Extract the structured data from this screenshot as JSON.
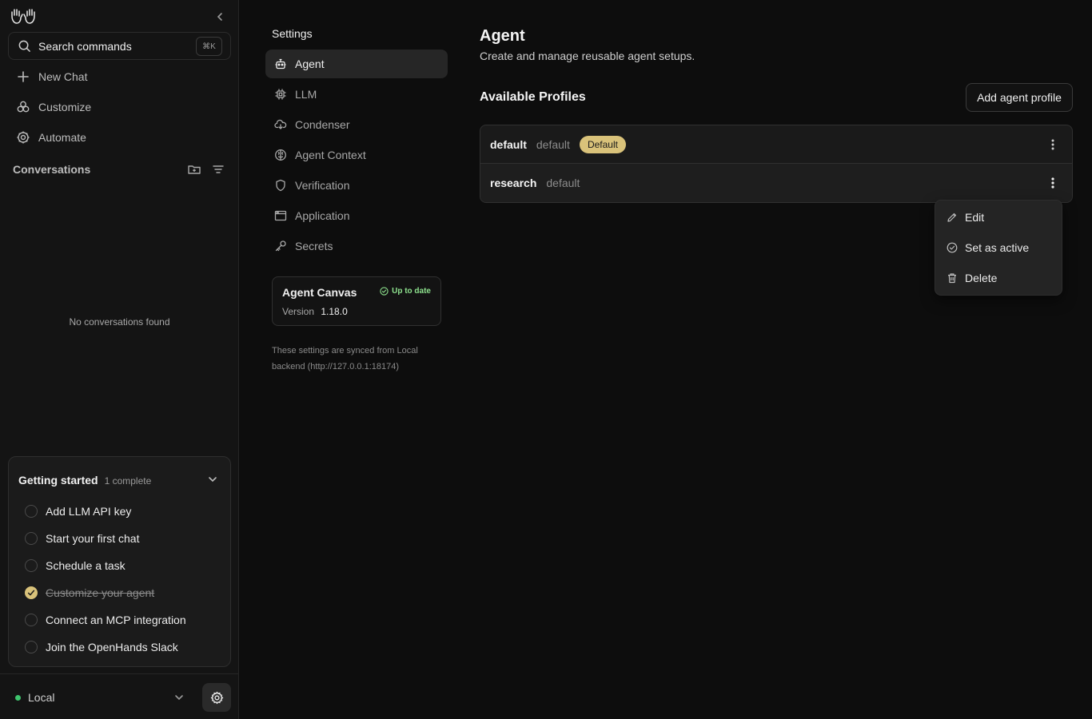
{
  "sidebar": {
    "search": {
      "label": "Search commands",
      "shortcut": "⌘K"
    },
    "nav": [
      {
        "label": "New Chat",
        "icon": "plus-icon"
      },
      {
        "label": "Customize",
        "icon": "customize-icon"
      },
      {
        "label": "Automate",
        "icon": "automate-gear-icon"
      }
    ],
    "conversations": {
      "title": "Conversations",
      "empty": "No conversations found"
    },
    "getting_started": {
      "title": "Getting started",
      "subtitle": "1 complete",
      "items": [
        {
          "label": "Add LLM API key",
          "done": false
        },
        {
          "label": "Start your first chat",
          "done": false
        },
        {
          "label": "Schedule a task",
          "done": false
        },
        {
          "label": "Customize your agent",
          "done": true
        },
        {
          "label": "Connect an MCP integration",
          "done": false
        },
        {
          "label": "Join the OpenHands Slack",
          "done": false
        }
      ]
    },
    "footer": {
      "backend": "Local",
      "status_color": "#3ec46d"
    }
  },
  "settings_nav": {
    "title": "Settings",
    "items": [
      {
        "label": "Agent",
        "icon": "robot-icon",
        "active": true
      },
      {
        "label": "LLM",
        "icon": "chip-icon",
        "active": false
      },
      {
        "label": "Condenser",
        "icon": "condenser-icon",
        "active": false
      },
      {
        "label": "Agent Context",
        "icon": "brain-icon",
        "active": false
      },
      {
        "label": "Verification",
        "icon": "shield-icon",
        "active": false
      },
      {
        "label": "Application",
        "icon": "window-icon",
        "active": false
      },
      {
        "label": "Secrets",
        "icon": "key-icon",
        "active": false
      }
    ],
    "version_card": {
      "name": "Agent Canvas",
      "status": "Up to date",
      "version_label": "Version",
      "version": "1.18.0"
    },
    "sync_note": "These settings are synced from Local backend (http://127.0.0.1:18174)"
  },
  "main": {
    "title": "Agent",
    "subtitle": "Create and manage reusable agent setups.",
    "profiles_title": "Available Profiles",
    "add_button": "Add agent profile",
    "profiles": [
      {
        "name": "default",
        "model": "default",
        "badge": "Default"
      },
      {
        "name": "research",
        "model": "default",
        "badge": ""
      }
    ],
    "context_menu": [
      {
        "label": "Edit",
        "icon": "pencil-icon"
      },
      {
        "label": "Set as active",
        "icon": "check-circle-icon"
      },
      {
        "label": "Delete",
        "icon": "trash-icon"
      }
    ]
  },
  "colors": {
    "accent": "#d9c27a",
    "success": "#8ee28e",
    "background": "#0d0d0d"
  }
}
